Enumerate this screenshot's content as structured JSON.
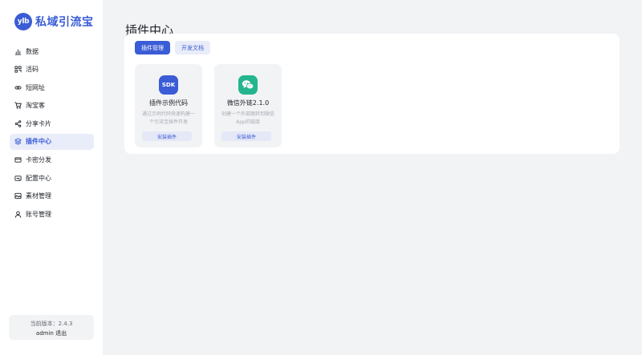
{
  "brand": {
    "logo_text": "ylb",
    "name": "私域引流宝"
  },
  "colors": {
    "accent": "#3a5cd6",
    "wechat": "#24b58f",
    "active_bg": "#e9ecf9"
  },
  "sidebar": {
    "items": [
      {
        "label": "数据",
        "icon": "chart-bar-icon",
        "active": false
      },
      {
        "label": "活码",
        "icon": "qr-code-icon",
        "active": false
      },
      {
        "label": "短网址",
        "icon": "link-icon",
        "active": false
      },
      {
        "label": "淘宝客",
        "icon": "cart-icon",
        "active": false
      },
      {
        "label": "分享卡片",
        "icon": "share-icon",
        "active": false
      },
      {
        "label": "插件中心",
        "icon": "layers-icon",
        "active": true
      },
      {
        "label": "卡密分发",
        "icon": "card-icon",
        "active": false
      },
      {
        "label": "配置中心",
        "icon": "config-icon",
        "active": false
      },
      {
        "label": "素材管理",
        "icon": "image-icon",
        "active": false
      },
      {
        "label": "账号管理",
        "icon": "user-icon",
        "active": false
      }
    ],
    "version": "当前版本：2.4.3",
    "username": "admin",
    "logout": "退出"
  },
  "main": {
    "title": "插件中心",
    "tabs": [
      {
        "label": "插件管理",
        "active": true
      },
      {
        "label": "开发文档",
        "active": false
      }
    ],
    "plugins": [
      {
        "icon_text": "SDK",
        "title": "插件示例代码",
        "desc": "通过示例代码快速构建一个引流宝插件开发",
        "button": "安装插件"
      },
      {
        "icon_text": "",
        "title": "微信外链2.1.0",
        "desc": "创建一个外部跳转到微信App的链接",
        "button": "安装插件"
      }
    ]
  }
}
